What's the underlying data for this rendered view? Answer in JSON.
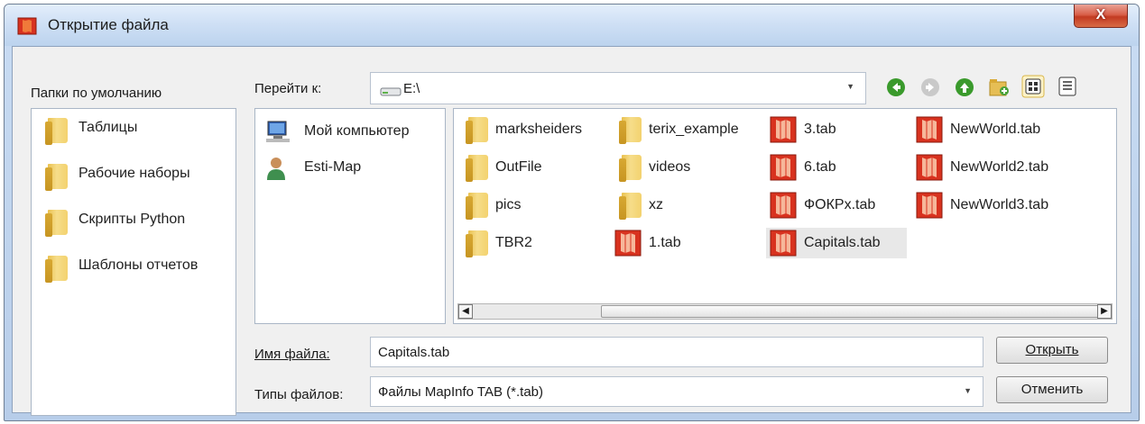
{
  "window": {
    "title": "Открытие файла",
    "close_label": "X"
  },
  "sidebar": {
    "heading": "Папки по умолчанию",
    "items": [
      {
        "label": "Таблицы",
        "icon": "folder-icon"
      },
      {
        "label": "Рабочие наборы",
        "icon": "folder-icon"
      },
      {
        "label": "Скрипты Python",
        "icon": "folder-icon"
      },
      {
        "label": "Шаблоны отчетов",
        "icon": "folder-icon"
      }
    ]
  },
  "navigation": {
    "goto_label": "Перейти к:",
    "path_value": "E:\\",
    "path_icon": "drive-icon",
    "buttons": [
      "back-arrow-icon",
      "forward-arrow-icon",
      "up-arrow-icon",
      "new-folder-icon",
      "icon-view-icon",
      "list-view-icon"
    ]
  },
  "places": [
    {
      "label": "Мой компьютер",
      "icon": "computer-icon"
    },
    {
      "label": "Esti-Map",
      "icon": "user-icon"
    }
  ],
  "files": {
    "columns": [
      [
        {
          "label": "marksheiders",
          "type": "folder"
        },
        {
          "label": "OutFile",
          "type": "folder"
        },
        {
          "label": "pics",
          "type": "folder"
        },
        {
          "label": "TBR2",
          "type": "folder"
        }
      ],
      [
        {
          "label": "terix_example",
          "type": "folder"
        },
        {
          "label": "videos",
          "type": "folder"
        },
        {
          "label": "xz",
          "type": "folder"
        },
        {
          "label": "1.tab",
          "type": "tab"
        }
      ],
      [
        {
          "label": "3.tab",
          "type": "tab"
        },
        {
          "label": "6.tab",
          "type": "tab"
        },
        {
          "label": "ФОКРх.tab",
          "type": "tab"
        },
        {
          "label": "Capitals.tab",
          "type": "tab",
          "selected": true
        }
      ],
      [
        {
          "label": "NewWorld.tab",
          "type": "tab"
        },
        {
          "label": "NewWorld2.tab",
          "type": "tab"
        },
        {
          "label": "NewWorld3.tab",
          "type": "tab"
        }
      ]
    ]
  },
  "filename": {
    "label": "Имя файла:",
    "value": "Capitals.tab"
  },
  "filetype": {
    "label": "Типы файлов:",
    "value": "Файлы MapInfo TAB (*.tab)"
  },
  "buttons": {
    "open": "Открыть",
    "cancel": "Отменить"
  },
  "colors": {
    "accent_green": "#3a9a2c",
    "tab_icon_red": "#d8321f",
    "selection_gray": "#e8e8e8"
  }
}
